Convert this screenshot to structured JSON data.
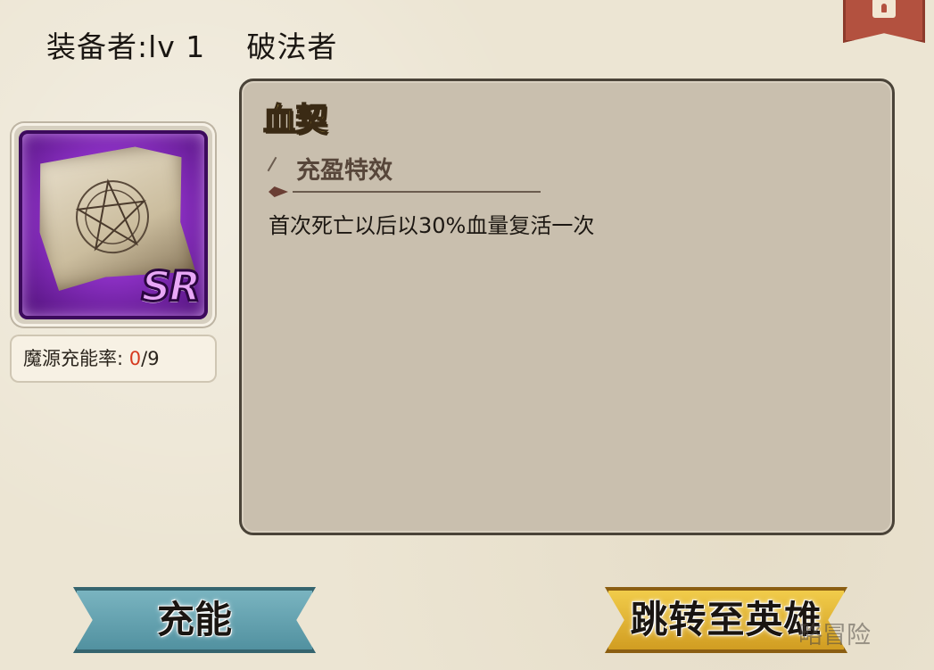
{
  "header": {
    "equipper_label": "装备者:lv 1",
    "hero_name": "破法者"
  },
  "item": {
    "name": "血契",
    "rarity": "SR",
    "icon_name": "blood-contract-scroll-icon",
    "charge_label": "魔源充能率: ",
    "charge_current": "0",
    "charge_max": "/9"
  },
  "effect": {
    "section_title": "充盈特效",
    "description": "首次死亡以后以30%血量复活一次"
  },
  "buttons": {
    "charge": "充能",
    "jump_to_hero": "跳转至英雄"
  },
  "watermark": "略冒险",
  "colors": {
    "title_gold": "#fce267",
    "charge_red": "#d63a1f",
    "rarity_purple": "#8a2fc2",
    "button_teal": "#4f8f9e",
    "button_gold": "#cf9a1f",
    "bookmark_red": "#b3513f"
  }
}
